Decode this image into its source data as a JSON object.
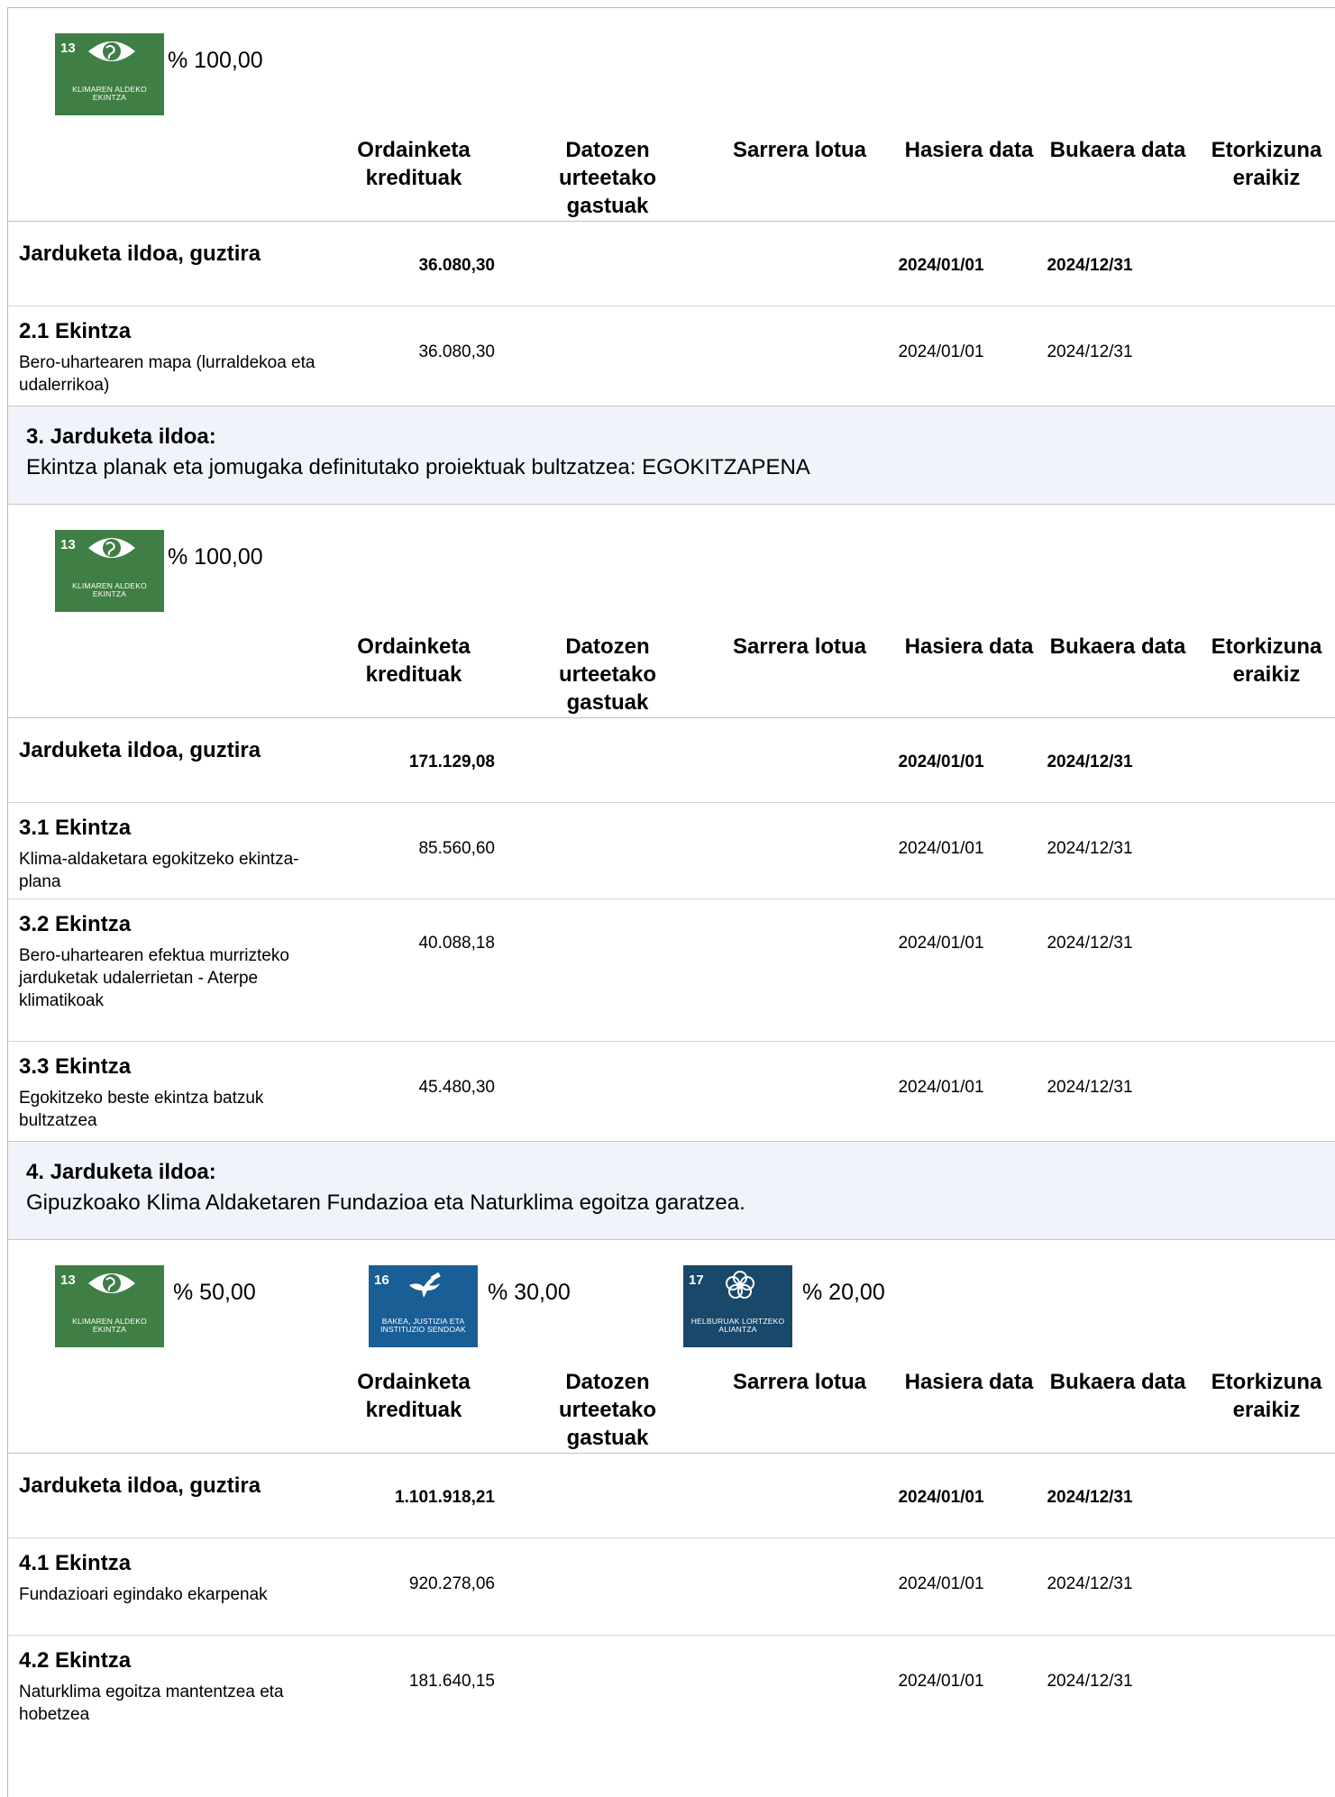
{
  "columns": {
    "credits": "Ordainketa kredituak",
    "future": "Datozen urteetako gastuak",
    "revenue": "Sarrera lotua",
    "start": "Hasiera data",
    "end": "Bukaera data",
    "future_build": "Etorkizuna eraikiz"
  },
  "goals": {
    "g13": {
      "number": "13",
      "caption": "KLIMAREN ALDEKO EKINTZA",
      "icon": "globe-eye-icon",
      "color": "#3f7e44"
    },
    "g16": {
      "number": "16",
      "caption": "BAKEA, JUSTIZIA ETA INSTITUZIO SENDOAK",
      "icon": "dove-gavel-icon",
      "color": "#1a5e96"
    },
    "g17": {
      "number": "17",
      "caption": "HELBURUAK LORTZEKO ALIANTZA",
      "icon": "linked-circles-icon",
      "color": "#19486a"
    }
  },
  "block1": {
    "goal1_pct": "% 100,00",
    "total": {
      "label": "Jarduketa ildoa, guztira",
      "amount": "36.080,30",
      "start": "2024/01/01",
      "end": "2024/12/31"
    },
    "rows": [
      {
        "title": "2.1 Ekintza",
        "desc": "Bero-uhartearen mapa (lurraldekoa eta udalerrikoa)",
        "amount": "36.080,30",
        "start": "2024/01/01",
        "end": "2024/12/31"
      }
    ]
  },
  "section3": {
    "title": "3. Jarduketa ildoa:",
    "desc": "Ekintza planak eta jomugaka definitutako proiektuak bultzatzea: EGOKITZAPENA"
  },
  "block3": {
    "goal1_pct": "% 100,00",
    "total": {
      "label": "Jarduketa ildoa, guztira",
      "amount": "171.129,08",
      "start": "2024/01/01",
      "end": "2024/12/31"
    },
    "rows": [
      {
        "title": "3.1 Ekintza",
        "desc": "Klima-aldaketara egokitzeko ekintza-plana",
        "amount": "85.560,60",
        "start": "2024/01/01",
        "end": "2024/12/31"
      },
      {
        "title": "3.2 Ekintza",
        "desc": "Bero-uhartearen efektua murrizteko jarduketak udalerrietan - Aterpe klimatikoak",
        "amount": "40.088,18",
        "start": "2024/01/01",
        "end": "2024/12/31"
      },
      {
        "title": "3.3 Ekintza",
        "desc": "Egokitzeko beste ekintza batzuk bultzatzea",
        "amount": "45.480,30",
        "start": "2024/01/01",
        "end": "2024/12/31"
      }
    ]
  },
  "section4": {
    "title": "4. Jarduketa ildoa:",
    "desc": "Gipuzkoako Klima Aldaketaren Fundazioa eta Naturklima egoitza garatzea."
  },
  "block4": {
    "goal1_pct": "% 50,00",
    "goal2_pct": "% 30,00",
    "goal3_pct": "% 20,00",
    "total": {
      "label": "Jarduketa ildoa, guztira",
      "amount": "1.101.918,21",
      "start": "2024/01/01",
      "end": "2024/12/31"
    },
    "rows": [
      {
        "title": "4.1 Ekintza",
        "desc": "Fundazioari egindako ekarpenak",
        "amount": "920.278,06",
        "start": "2024/01/01",
        "end": "2024/12/31"
      },
      {
        "title": "4.2 Ekintza",
        "desc": "Naturklima egoitza mantentzea eta hobetzea",
        "amount": "181.640,15",
        "start": "2024/01/01",
        "end": "2024/12/31"
      }
    ]
  }
}
